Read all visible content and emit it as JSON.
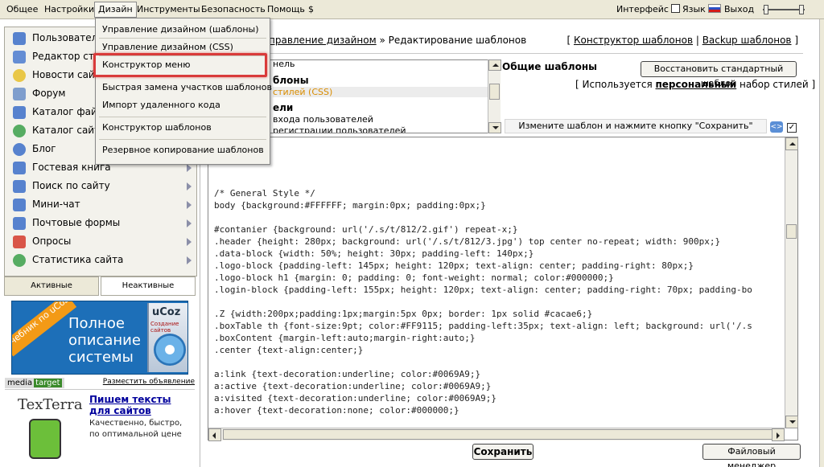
{
  "topbar": {
    "menu": [
      "Общее",
      "Настройки",
      "Дизайн",
      "Инструменты",
      "Безопасность",
      "Помощь",
      "$"
    ],
    "active": "Дизайн",
    "interface_label": "Интерфейс",
    "lang_label": "Язык",
    "logout_label": "Выход"
  },
  "dropdown": {
    "items": [
      "Управление дизайном (шаблоны)",
      "Управление дизайном (CSS)",
      "Конструктор меню",
      "Быстрая замена участков шаблонов",
      "Импорт удаленного кода",
      "Конструктор шаблонов",
      "Резервное копирование шаблонов"
    ],
    "highlighted": "Конструктор меню"
  },
  "sidebar": {
    "items": [
      {
        "label": "Пользователи",
        "icon": "users-icon",
        "color": "#3b6fc9"
      },
      {
        "label": "Редактор стр",
        "icon": "page-editor-icon",
        "color": "#4a7bd0"
      },
      {
        "label": "Новости сайт",
        "icon": "lightbulb-icon",
        "color": "#e6c02a"
      },
      {
        "label": "Форум",
        "icon": "forum-icon",
        "color": "#6a8fc8"
      },
      {
        "label": "Каталог файл",
        "icon": "file-catalog-icon",
        "color": "#3b6fc9"
      },
      {
        "label": "Каталог сайто",
        "icon": "globe-icon",
        "color": "#3aa04a"
      },
      {
        "label": "Блог",
        "icon": "blog-icon",
        "color": "#3b6fc9"
      },
      {
        "label": "Гостевая книга",
        "icon": "book-icon",
        "color": "#3b6fc9"
      },
      {
        "label": "Поиск по сайту",
        "icon": "search-icon",
        "color": "#3b6fc9"
      },
      {
        "label": "Мини-чат",
        "icon": "chat-icon",
        "color": "#3b6fc9"
      },
      {
        "label": "Почтовые формы",
        "icon": "mail-icon",
        "color": "#3b6fc9"
      },
      {
        "label": "Опросы",
        "icon": "poll-icon",
        "color": "#d33a2c"
      },
      {
        "label": "Статистика сайта",
        "icon": "stats-icon",
        "color": "#3aa04a"
      }
    ],
    "tabs": [
      "Активные",
      "Неактивные"
    ]
  },
  "banner": {
    "ribbon": "учебник по uCoz",
    "text": "Полное описание системы",
    "box_title": "uCoz",
    "box_subtitle": "Создание сайтов"
  },
  "ad": {
    "tag1": "media",
    "tag2": "target",
    "place_link": "Разместить объявление",
    "logo": "TexTerra",
    "title": "Пишем тексты для сайтов",
    "desc": "Качественно, быстро, по оптимальной цене"
  },
  "breadcrumb": {
    "link": "правление дизайном",
    "sep": " » ",
    "current": "Редактирование шаблонов",
    "right_link1": "Конструктор шаблонов",
    "right_link2": "Backup шаблонов"
  },
  "templates_list": {
    "rows": [
      {
        "text": "нель",
        "style": "normal"
      },
      {
        "text": "блоны",
        "style": "bold"
      },
      {
        "text": "стилей (CSS)",
        "style": "selected"
      },
      {
        "text": "ели",
        "style": "bold"
      },
      {
        "text": "входа пользователей",
        "style": "normal"
      },
      {
        "text": "регистрации пользователей",
        "style": "normal"
      }
    ]
  },
  "common": {
    "title": "Общие шаблоны",
    "restore_button": "Восстановить стандартный шаблон",
    "uses_prefix": "[ Используется ",
    "uses_bold": "персональный",
    "uses_suffix": " набор стилей ]",
    "hint": "Измените шаблон и нажмите кнопку \"Сохранить\""
  },
  "editor": {
    "lines": [
      "/* General Style */",
      "body {background:#FFFFFF; margin:0px; padding:0px;}",
      "",
      "#contanier {background: url('/.s/t/812/2.gif') repeat-x;}",
      ".header {height: 280px; background: url('/.s/t/812/3.jpg') top center no-repeat; width: 900px;}",
      ".data-block {width: 50%; height: 30px; padding-left: 140px;}",
      ".logo-block {padding-left: 145px; height: 120px; text-align: center; padding-right: 80px;}",
      ".logo-block h1 {margin: 0; padding: 0; font-weight: normal; color:#000000;}",
      ".login-block {padding-left: 155px; height: 120px; text-align: center; padding-right: 70px; padding-bo",
      "",
      ".Z {width:200px;padding:1px;margin:5px 0px; border: 1px solid #cacae6;}",
      ".boxTable th {font-size:9pt; color:#FF9115; padding-left:35px; text-align: left; background: url('/.s",
      ".boxContent {margin-left:auto;margin-right:auto;}",
      ".center {text-align:center;}",
      "",
      "a:link {text-decoration:underline; color:#0069A9;}",
      "a:active {text-decoration:underline; color:#0069A9;}",
      "a:visited {text-decoration:underline; color:#0069A9;}",
      "a:hover {text-decoration:none; color:#000000;}"
    ]
  },
  "buttons": {
    "save": "Сохранить",
    "file_manager": "Файловый менеджер"
  }
}
